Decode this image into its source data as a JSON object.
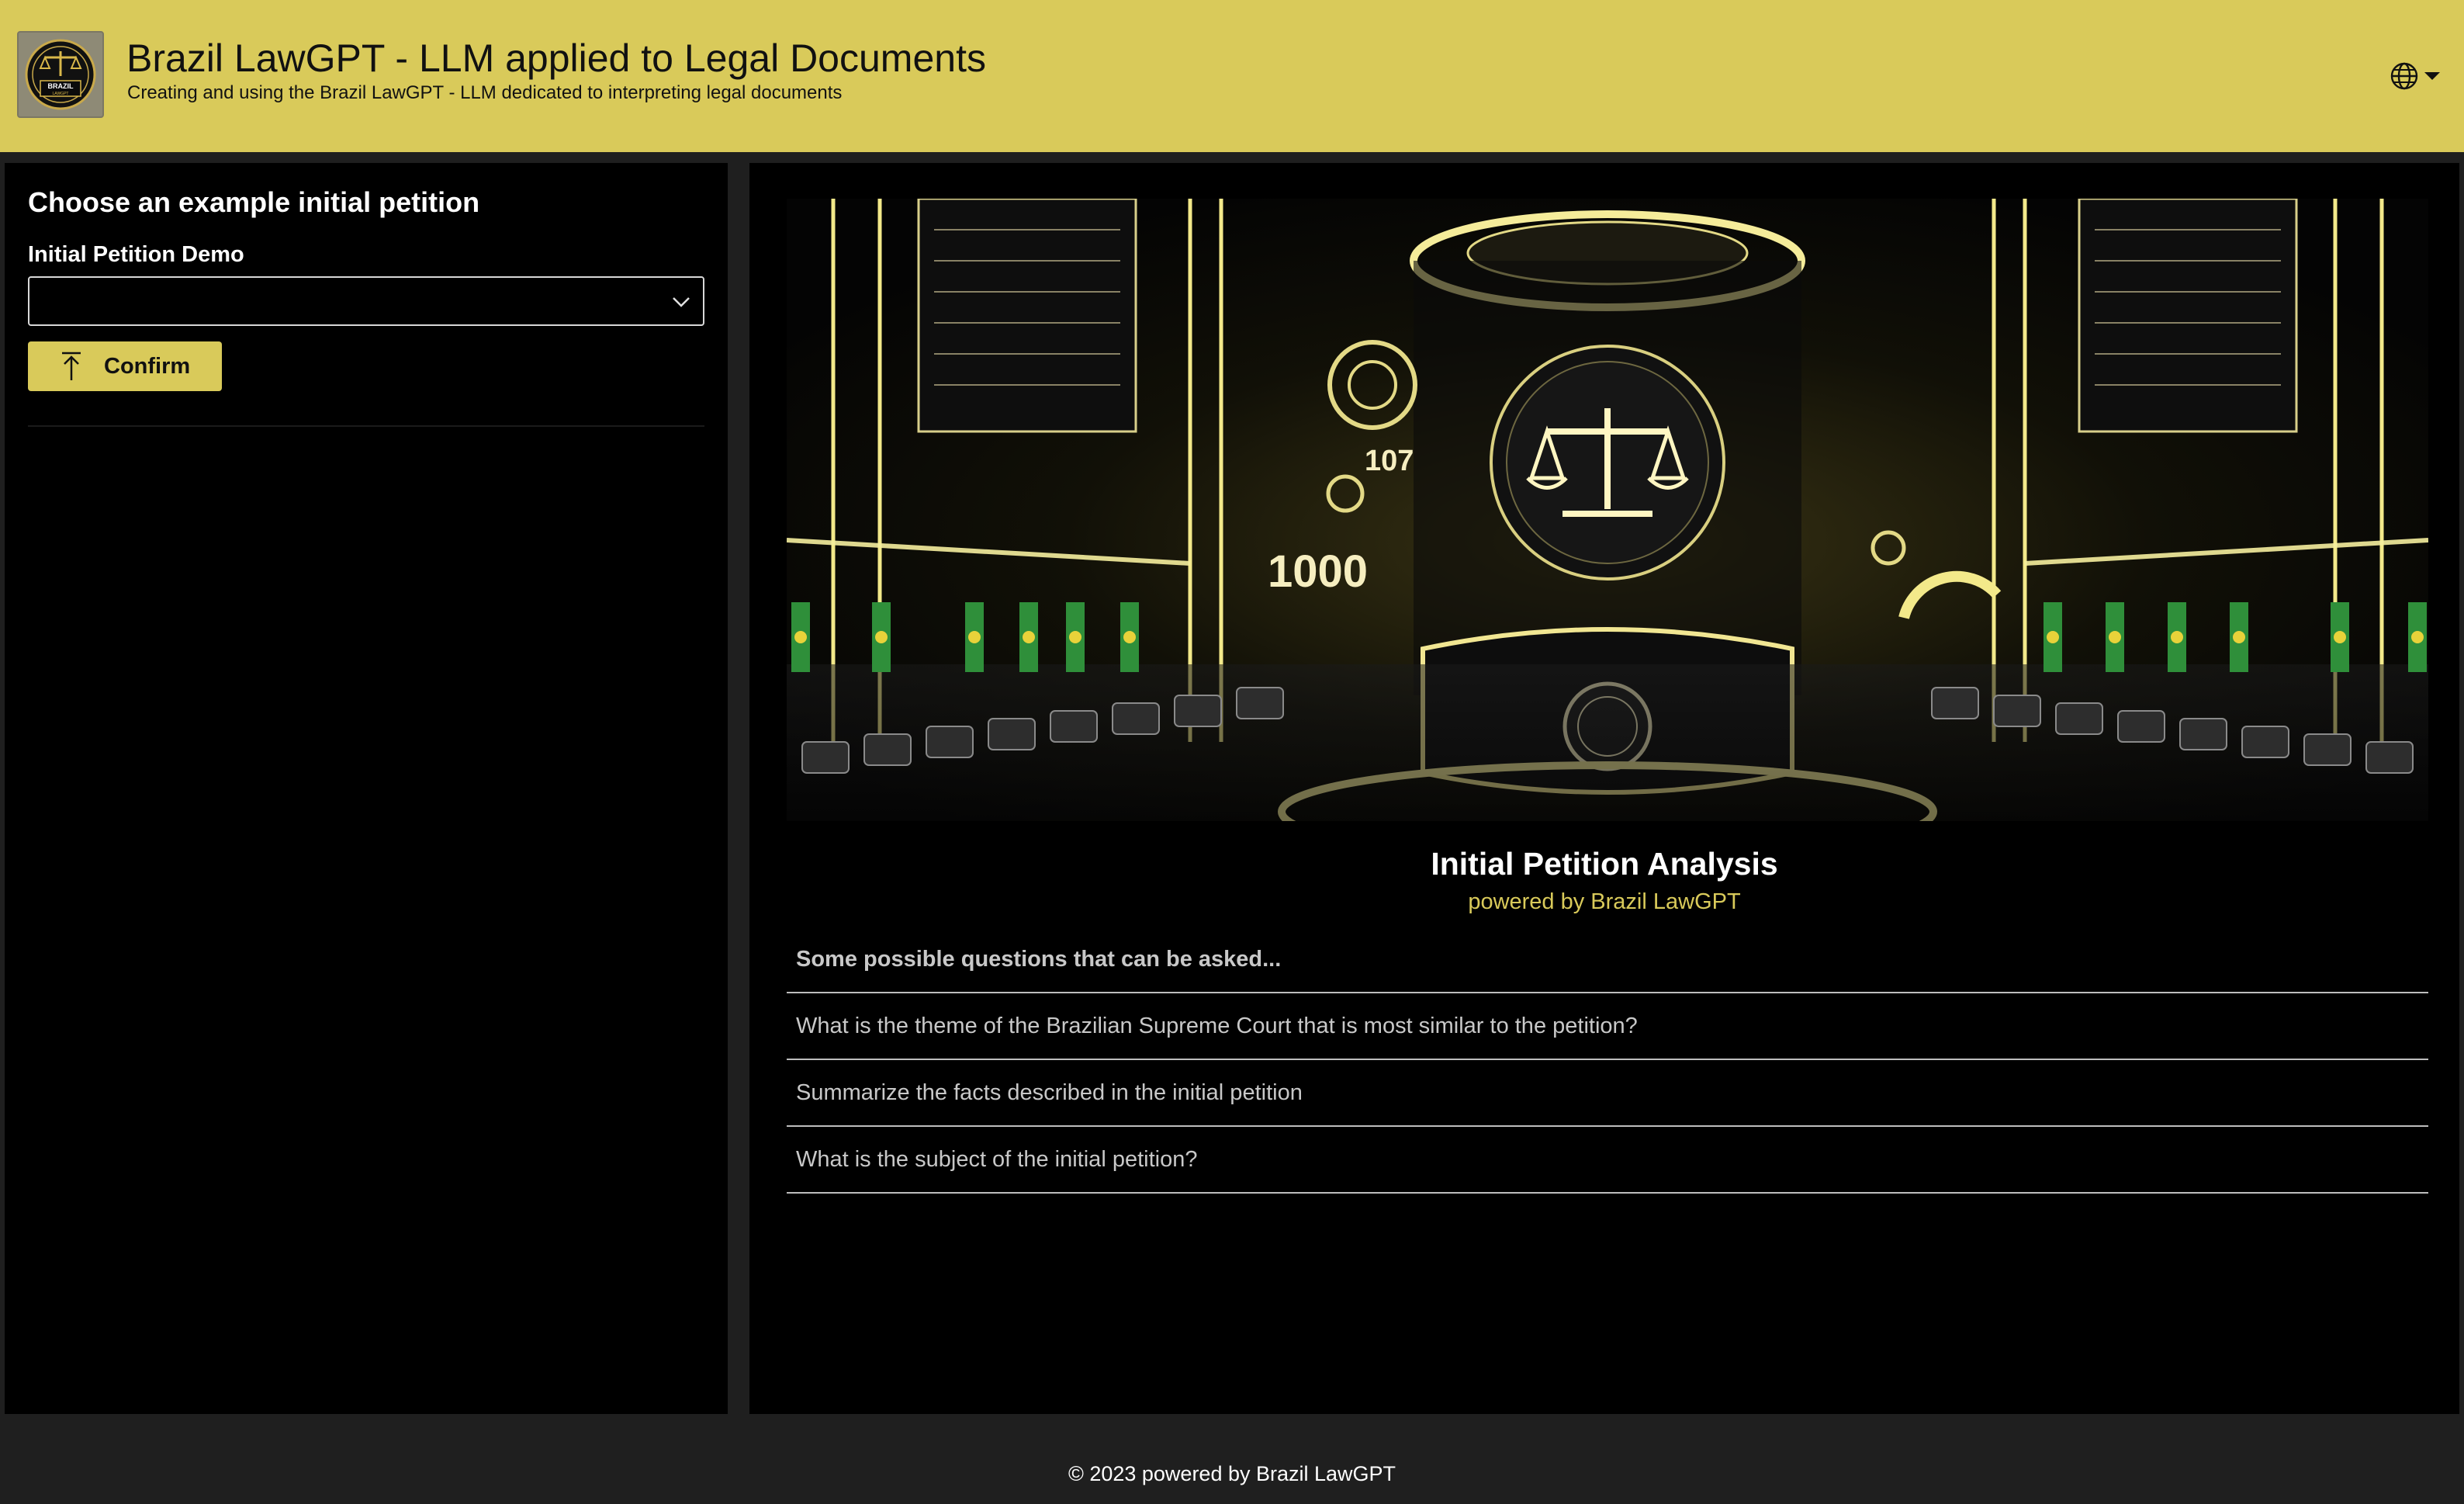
{
  "header": {
    "title": "Brazil LawGPT - LLM applied to Legal Documents",
    "subtitle": "Creating and using the Brazil LawGPT - LLM dedicated to interpreting legal documents",
    "logo_text": "BRAZIL",
    "logo_subtext": "LAWGPT",
    "language_icon": "globe-icon"
  },
  "sidebar": {
    "heading": "Choose an example initial petition",
    "select_label": "Initial Petition Demo",
    "select_value": "",
    "confirm_label": "Confirm"
  },
  "main": {
    "hero_numbers": [
      "107",
      "1000"
    ],
    "analysis_title": "Initial Petition Analysis",
    "analysis_subtitle": "powered by Brazil LawGPT",
    "questions_header": "Some possible questions that can be asked...",
    "questions": [
      "What is the theme of the Brazilian Supreme Court that is most similar to the petition?",
      "Summarize the facts described in the initial petition",
      "What is the subject of the initial petition?"
    ]
  },
  "footer": {
    "text": "© 2023 powered by Brazil LawGPT"
  },
  "colors": {
    "accent": "#d9ca5a",
    "background": "#1f1f1f",
    "panel": "#000000"
  }
}
